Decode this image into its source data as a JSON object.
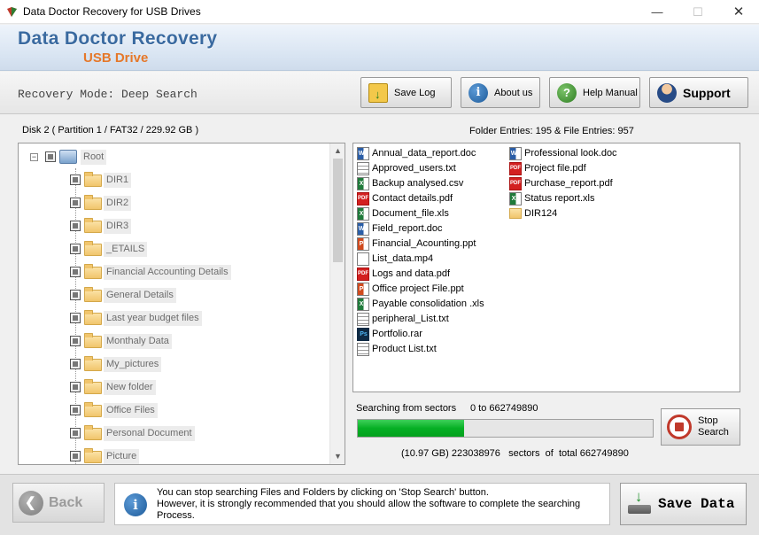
{
  "window": {
    "title": "Data Doctor Recovery for USB Drives",
    "min_glyph": "—",
    "max_glyph": "☐",
    "close_glyph": "✕"
  },
  "banner": {
    "brand": "Data Doctor Recovery",
    "product": "USB Drive"
  },
  "toolbar": {
    "mode_label": "Recovery Mode: Deep Search",
    "save_log": "Save Log",
    "about": "About us",
    "help": "Help Manual",
    "support": "Support"
  },
  "disk": {
    "label": "Disk 2 ( Partition 1 / FAT32 / 229.92 GB )",
    "entries": "Folder Entries: 195 & File Entries: 957"
  },
  "tree": {
    "root": "Root",
    "items": [
      "DIR1",
      "DIR2",
      "DIR3",
      "_ETAILS",
      "Financial Accounting Details",
      "General Details",
      "Last year budget files",
      "Monthaly Data",
      "My_pictures",
      "New folder",
      "Office Files",
      "Personal Document",
      "Picture"
    ]
  },
  "files": {
    "column1": [
      {
        "name": "Annual_data_report.doc",
        "icon": "doc"
      },
      {
        "name": "Approved_users.txt",
        "icon": "txt"
      },
      {
        "name": "Backup analysed.csv",
        "icon": "csv"
      },
      {
        "name": "Contact details.pdf",
        "icon": "pdf"
      },
      {
        "name": "Document_file.xls",
        "icon": "xls"
      },
      {
        "name": "Field_report.doc",
        "icon": "doc"
      },
      {
        "name": "Financial_Acounting.ppt",
        "icon": "ppt"
      },
      {
        "name": "List_data.mp4",
        "icon": "mp4"
      },
      {
        "name": "Logs and data.pdf",
        "icon": "pdf"
      },
      {
        "name": "Office project File.ppt",
        "icon": "ppt"
      },
      {
        "name": "Payable consolidation .xls",
        "icon": "xls"
      },
      {
        "name": "peripheral_List.txt",
        "icon": "txt"
      },
      {
        "name": "Portfolio.rar",
        "icon": "psd"
      },
      {
        "name": "Product List.txt",
        "icon": "txt"
      }
    ],
    "column2": [
      {
        "name": "Professional look.doc",
        "icon": "doc"
      },
      {
        "name": "Project file.pdf",
        "icon": "pdf"
      },
      {
        "name": "Purchase_report.pdf",
        "icon": "pdf"
      },
      {
        "name": "Status report.xls",
        "icon": "xls"
      },
      {
        "name": "DIR124",
        "icon": "folder"
      }
    ]
  },
  "progress": {
    "label": "Searching from sectors",
    "range": "0 to 662749890",
    "fraction": 0.36,
    "sectors_line": "(10.97 GB) 223038976   sectors  of  total 662749890",
    "stop_label_1": "Stop",
    "stop_label_2": "Search"
  },
  "bottom": {
    "back": "Back",
    "message_1": "You can stop searching Files and Folders by clicking on 'Stop Search' button.",
    "message_2": "However, it is strongly recommended that you should allow the software to complete the searching Process.",
    "save": "Save Data"
  }
}
